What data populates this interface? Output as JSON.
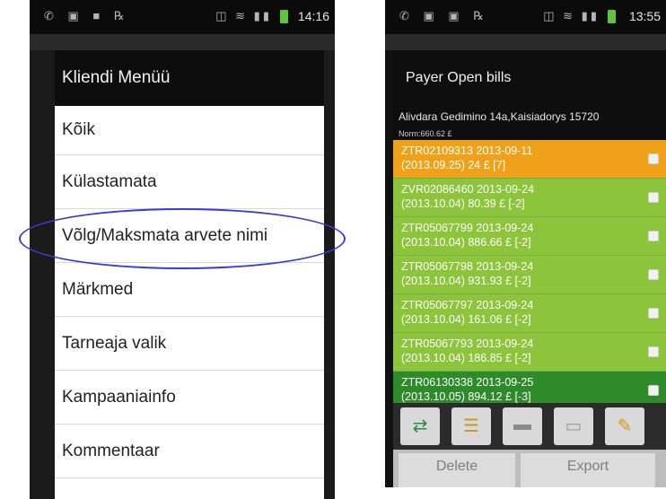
{
  "left_phone": {
    "status_time": "14:16",
    "battery_text": "100%",
    "menu_title": "Kliendi Menüü",
    "menu_items": [
      "Kõik",
      "Külastamata",
      "Võlg/Maksmata arvete nimi",
      "Märkmed",
      "Tarneaja valik",
      "Kampaaniainfo",
      "Kommentaar"
    ],
    "highlighted_item_index": 2,
    "highlight_color": "#3a3ad6"
  },
  "right_phone": {
    "status_time": "13:55",
    "battery_text": "95%",
    "panel_title": "Payer Open bills",
    "address": "Alivdara Gedimino 14a,Kaisiadorys 15720",
    "norm": "Norm:660.62 £",
    "bills": [
      {
        "line1": "ZTR02109313 2013-09-11",
        "line2": "(2013.09.25) 24 £ [7]",
        "status": "orange"
      },
      {
        "line1": "ZVR02086460 2013-09-24",
        "line2": "(2013.10.04) 80.39 £ [-2]",
        "status": "green"
      },
      {
        "line1": "ZTR05067799 2013-09-24",
        "line2": "(2013.10.04) 886.66 £ [-2]",
        "status": "green"
      },
      {
        "line1": "ZTR05067798 2013-09-24",
        "line2": "(2013.10.04) 931.93 £ [-2]",
        "status": "green"
      },
      {
        "line1": "ZTR05067797 2013-09-24",
        "line2": "(2013.10.04) 161.06 £ [-2]",
        "status": "green"
      },
      {
        "line1": "ZTR05067793 2013-09-24",
        "line2": "(2013.10.04) 186.85 £ [-2]",
        "status": "green"
      },
      {
        "line1": "ZTR06130338 2013-09-25",
        "line2": "(2013.10.05) 894.12 £ [-3]",
        "status": "dark"
      }
    ],
    "toolbar_icons": [
      "sync-icon",
      "list-icon",
      "minus-icon",
      "card-icon",
      "broom-icon"
    ],
    "bottom_buttons": [
      "Delete",
      "Export"
    ],
    "colors": {
      "orange": "#f0a11a",
      "green": "#8cc43c",
      "dark_green": "#2e8b2a"
    }
  }
}
